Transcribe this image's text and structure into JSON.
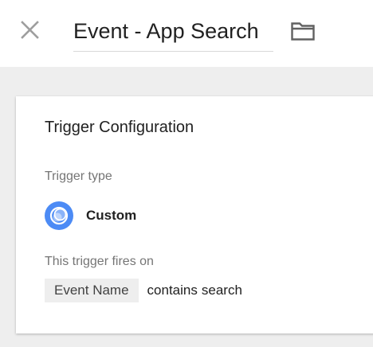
{
  "header": {
    "title": "Event - App Search",
    "close_icon": "close-icon",
    "folder_icon": "folder-icon"
  },
  "trigger": {
    "section_title": "Trigger Configuration",
    "type_label": "Trigger type",
    "type_name": "Custom",
    "type_icon": "custom-trigger-icon",
    "type_icon_color": "#4c8bf5",
    "fires_on_label": "This trigger fires on",
    "condition": {
      "variable": "Event Name",
      "operator": "contains",
      "value": "search"
    }
  }
}
